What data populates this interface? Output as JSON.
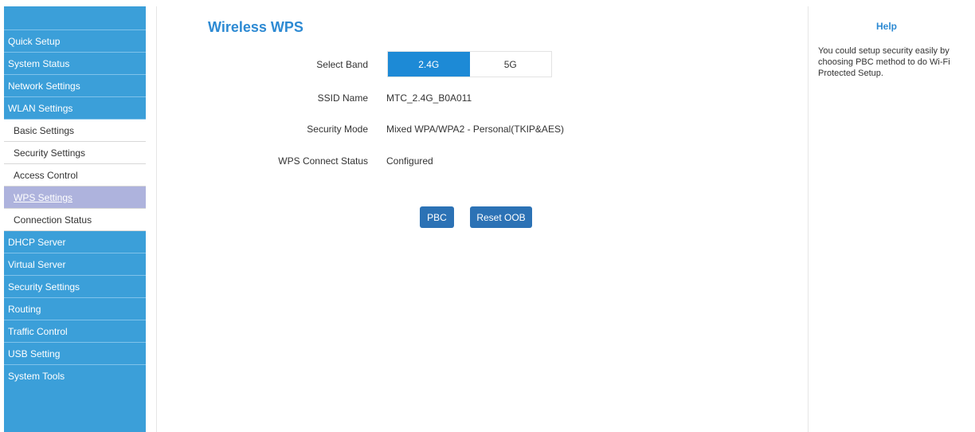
{
  "sidebar": {
    "items": [
      {
        "label": "Quick Setup"
      },
      {
        "label": "System Status"
      },
      {
        "label": "Network Settings"
      },
      {
        "label": "WLAN Settings"
      },
      {
        "label": "Basic Settings"
      },
      {
        "label": "Security Settings"
      },
      {
        "label": "Access Control"
      },
      {
        "label": "WPS Settings"
      },
      {
        "label": "Connection Status"
      },
      {
        "label": "DHCP Server"
      },
      {
        "label": "Virtual Server"
      },
      {
        "label": "Security Settings"
      },
      {
        "label": "Routing"
      },
      {
        "label": "Traffic Control"
      },
      {
        "label": "USB Setting"
      },
      {
        "label": "System Tools"
      }
    ]
  },
  "main": {
    "title": "Wireless WPS",
    "select_band": {
      "label": "Select Band",
      "options": [
        "2.4G",
        "5G"
      ],
      "selected": "2.4G"
    },
    "ssid": {
      "label": "SSID Name",
      "value": "MTC_2.4G_B0A011"
    },
    "security_mode": {
      "label": "Security Mode",
      "value": "Mixed WPA/WPA2 - Personal(TKIP&AES)"
    },
    "wps_status": {
      "label": "WPS Connect Status",
      "value": "Configured"
    },
    "buttons": {
      "pbc": "PBC",
      "reset": "Reset OOB"
    }
  },
  "help": {
    "title": "Help",
    "text": "You could setup security easily by choosing PBC method to do Wi-Fi Protected Setup."
  },
  "colors": {
    "sidebar_bg": "#3b9fd9",
    "active_sub_bg": "#aeb3dd",
    "title_blue": "#2d8ad3",
    "band_active": "#1d8ad6",
    "button_bg": "#2c72b5"
  }
}
